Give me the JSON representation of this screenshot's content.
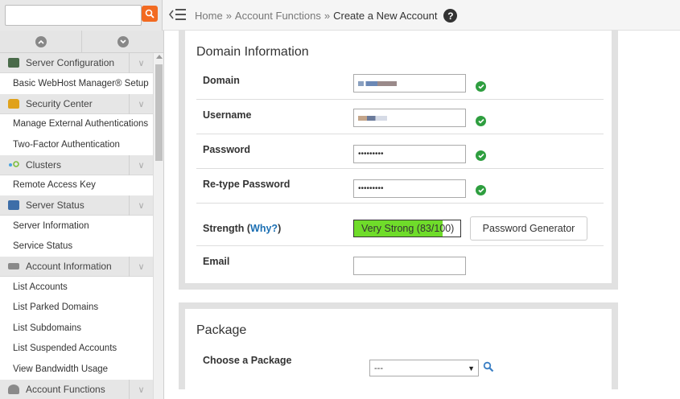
{
  "search": {
    "placeholder": "",
    "value": ""
  },
  "breadcrumb": {
    "home": "Home",
    "sep1": "»",
    "section": "Account Functions",
    "sep2": "»",
    "current": "Create a New Account"
  },
  "sidebar": {
    "sections": [
      {
        "label": "Server Configuration",
        "icon": "server-config-icon",
        "items": [
          "Basic WebHost Manager® Setup"
        ]
      },
      {
        "label": "Security Center",
        "icon": "lock-icon",
        "items": [
          "Manage External Authentications",
          "Two-Factor Authentication"
        ]
      },
      {
        "label": "Clusters",
        "icon": "clusters-icon",
        "items": [
          "Remote Access Key"
        ]
      },
      {
        "label": "Server Status",
        "icon": "monitor-icon",
        "items": [
          "Server Information",
          "Service Status"
        ]
      },
      {
        "label": "Account Information",
        "icon": "account-info-icon",
        "items": [
          "List Accounts",
          "List Parked Domains",
          "List Subdomains",
          "List Suspended Accounts",
          "View Bandwidth Usage"
        ]
      },
      {
        "label": "Account Functions",
        "icon": "user-icon",
        "items": []
      }
    ]
  },
  "domain_info": {
    "title": "Domain Information",
    "domain_label": "Domain",
    "username_label": "Username",
    "password_label": "Password",
    "password_value": "•••••••••",
    "retype_label": "Re-type Password",
    "retype_value": "•••••••••",
    "strength_label": "Strength",
    "why_link": "Why?",
    "strength_text": "Very Strong (83/100)",
    "strength_percent": 83,
    "generator_button": "Password Generator",
    "email_label": "Email",
    "email_value": ""
  },
  "package": {
    "title": "Package",
    "choose_label": "Choose a Package",
    "selected": "---"
  },
  "colors": {
    "accent": "#f26a21",
    "success": "#2e9e3f",
    "strength": "#6fdc2a",
    "link": "#1b6fb3"
  }
}
